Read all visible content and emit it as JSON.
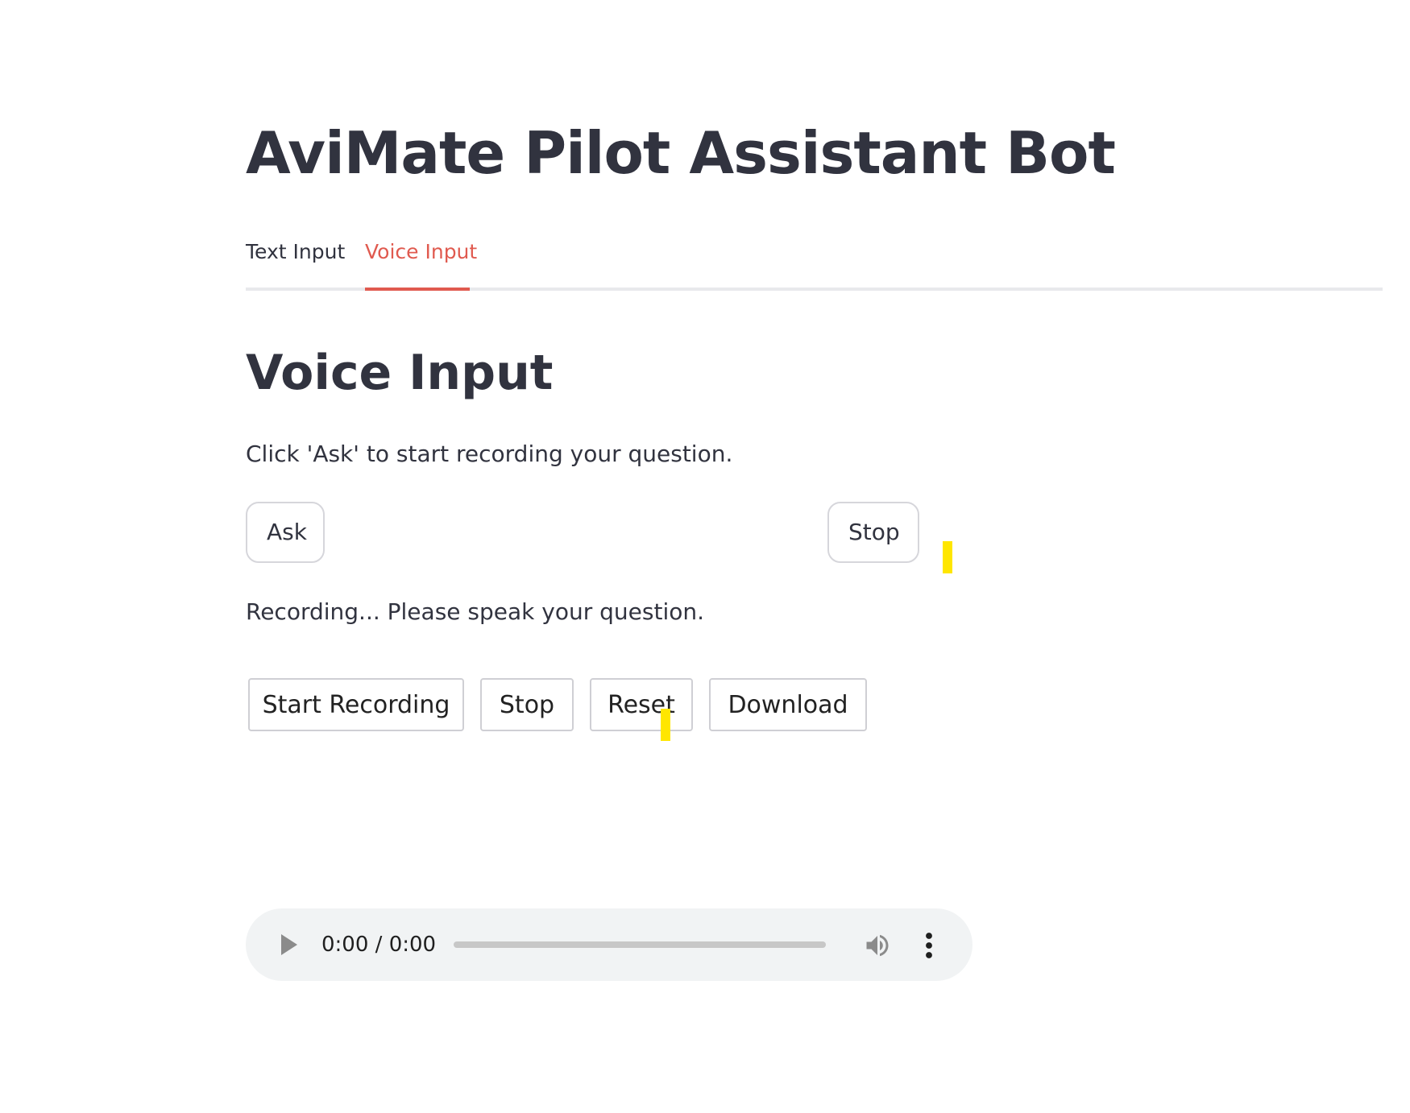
{
  "header": {
    "title": "AviMate Pilot Assistant Bot"
  },
  "tabs": [
    {
      "label": "Text Input",
      "active": false
    },
    {
      "label": "Voice Input",
      "active": true
    }
  ],
  "voice": {
    "heading": "Voice Input",
    "instruction": "Click 'Ask' to start recording your question.",
    "ask_label": "Ask",
    "stop_label": "Stop",
    "status": "Recording... Please speak your question."
  },
  "recorder": {
    "buttons": [
      "Start Recording",
      "Stop",
      "Reset",
      "Download"
    ]
  },
  "audio_player": {
    "current_time": "0:00",
    "separator": " / ",
    "duration": "0:00",
    "progress": 0,
    "play_icon": "play-icon",
    "volume_icon": "volume-icon",
    "menu_icon": "more-vert-icon"
  },
  "colors": {
    "accent": "#e05a4f",
    "text": "#31333f",
    "cursor_highlight": "#ffe600",
    "player_bg": "#f1f3f4"
  }
}
